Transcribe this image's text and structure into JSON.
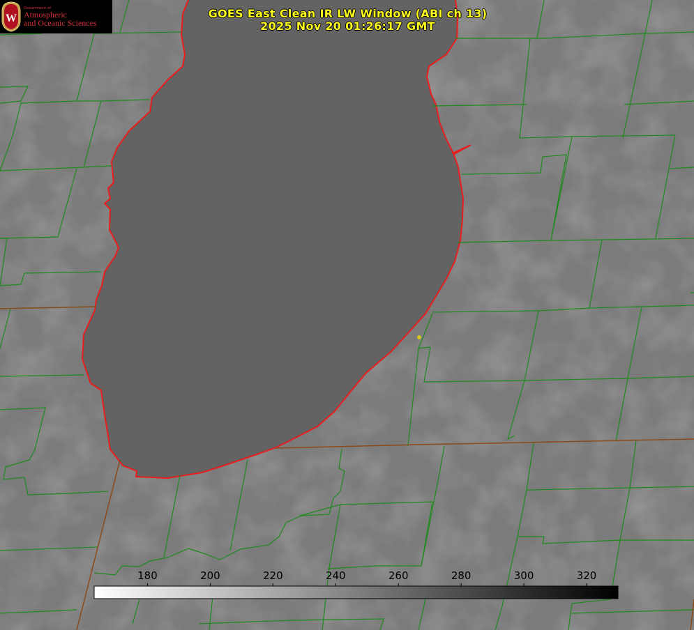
{
  "logo": {
    "department": "Department of",
    "line1": "Atmospheric",
    "line2": "and Oceanic Sciences",
    "letter": "W"
  },
  "title": {
    "line1": "GOES East Clean IR LW Window (ABI ch 13)",
    "line2": "2025 Nov 20 01:26:17 GMT"
  },
  "colorbar": {
    "min": 163,
    "max": 330,
    "ticks": [
      180,
      200,
      220,
      240,
      260,
      280,
      300,
      320
    ],
    "gradient": [
      "#ffffff",
      "#000000"
    ]
  },
  "colors": {
    "county_lines": "#1e8a1e",
    "state_lines": "#8a4a1a",
    "lake_outline": "#e81e1e",
    "title_text": "#ffff1e",
    "logo_text": "#d4303a",
    "marker": "#d4c81e"
  }
}
